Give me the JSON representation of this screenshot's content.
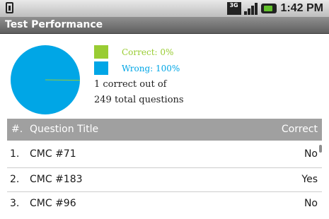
{
  "status_bar": {
    "time": "1:42 PM",
    "network": "3G"
  },
  "app": {
    "title": "Test Performance"
  },
  "chart": {
    "correct_label": "Correct: 0%",
    "wrong_label": "Wrong: 100%",
    "correct_color": "#99cc33",
    "wrong_color": "#00a6e6",
    "summary_line1": "1 correct out of",
    "summary_line2": "249 total questions"
  },
  "table": {
    "headers": {
      "number": "#.",
      "title": "Question Title",
      "correct": "Correct"
    },
    "rows": [
      {
        "num": "1.",
        "title": "CMC #71",
        "correct": "No"
      },
      {
        "num": "2.",
        "title": "CMC #183",
        "correct": "Yes"
      },
      {
        "num": "3.",
        "title": "CMC #96",
        "correct": "No"
      }
    ]
  }
}
